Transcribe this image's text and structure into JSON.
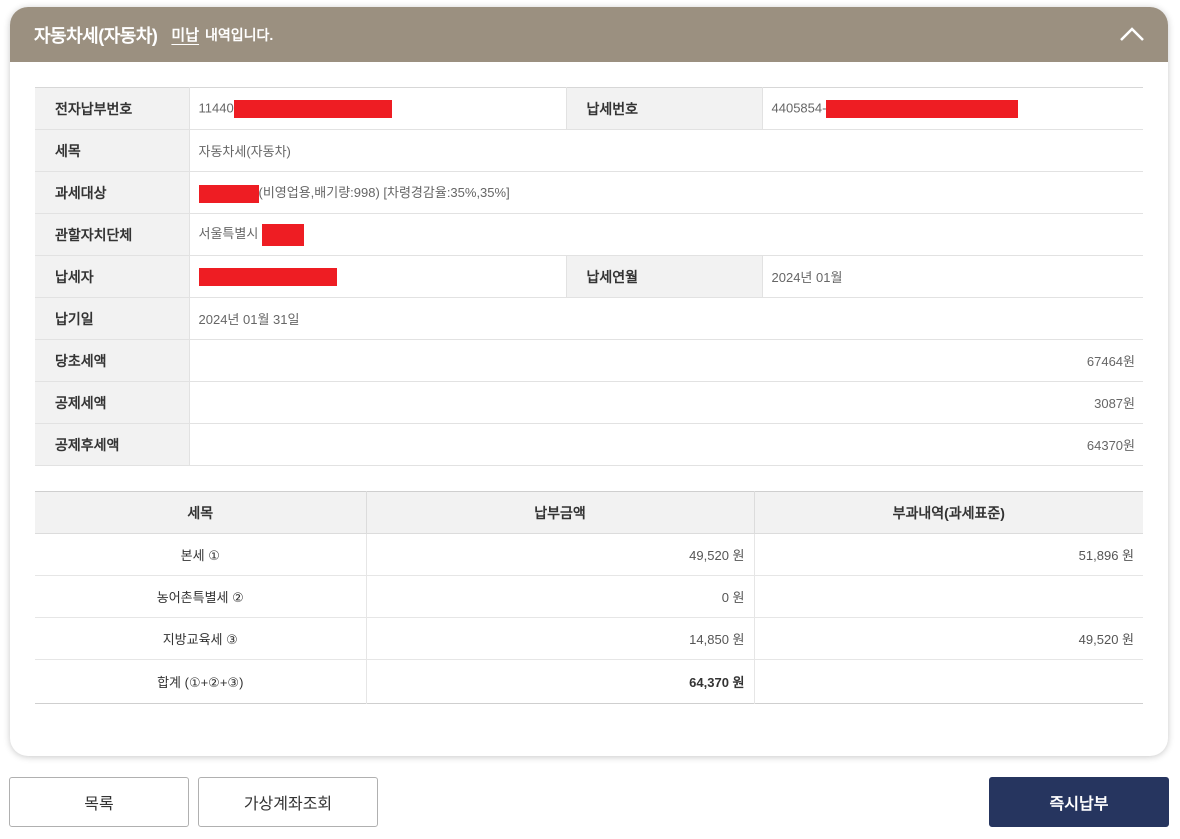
{
  "header": {
    "title": "자동차세(자동차)",
    "status": "미납",
    "suffix": "내역입니다.",
    "collapse_icon": "chevron-up-icon"
  },
  "info": {
    "electronic_payment_no_label": "전자납부번호",
    "electronic_payment_no": "11440",
    "tax_payment_no_label": "납세번호",
    "tax_payment_no": "4405854-",
    "tax_item_label": "세목",
    "tax_item": "자동차세(자동차)",
    "taxable_object_label": "과세대상",
    "taxable_object_detail": "(비영업용,배기량:998) [차령경감율:35%,35%]",
    "local_gov_label": "관할자치단체",
    "local_gov": "서울특별시",
    "taxpayer_label": "납세자",
    "tax_year_month_label": "납세연월",
    "tax_year_month": "2024년 01월",
    "due_date_label": "납기일",
    "due_date": "2024년 01월 31일",
    "original_tax_label": "당초세액",
    "original_tax": "67464원",
    "deduction_label": "공제세액",
    "deduction": "3087원",
    "after_deduction_label": "공제후세액",
    "after_deduction": "64370원"
  },
  "tax_table": {
    "headers": [
      "세목",
      "납부금액",
      "부과내역(과세표준)"
    ],
    "rows": [
      {
        "name": "본세 ①",
        "amount": "49,520 원",
        "base": "51,896 원"
      },
      {
        "name": "농어촌특별세 ②",
        "amount": "0 원",
        "base": ""
      },
      {
        "name": "지방교육세 ③",
        "amount": "14,850 원",
        "base": "49,520 원"
      },
      {
        "name": "합계 (①+②+③)",
        "amount": "64,370 원",
        "base": ""
      }
    ]
  },
  "buttons": {
    "list": "목록",
    "virtual_account": "가상계좌조회",
    "pay_now": "즉시납부"
  },
  "colors": {
    "header_bg": "#9b9080",
    "primary_button": "#26355f",
    "redaction": "#ee1d23"
  }
}
